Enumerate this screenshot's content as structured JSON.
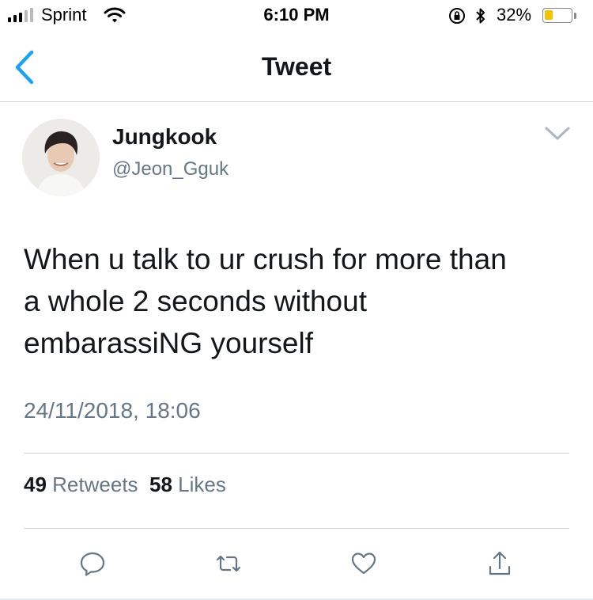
{
  "status_bar": {
    "carrier": "Sprint",
    "time": "6:10 PM",
    "battery_percent_text": "32%",
    "battery_level": 0.32,
    "signal_bars": 3,
    "icons": [
      "signal-icon",
      "wifi-icon",
      "rotation-lock-icon",
      "bluetooth-icon",
      "battery-icon"
    ]
  },
  "nav": {
    "title": "Tweet",
    "back_icon": "chevron-left-icon"
  },
  "tweet": {
    "author_name": "Jungkook",
    "author_handle": "@Jeon_Gguk",
    "text_lines": [
      "When u talk to ur crush for more than",
      "a whole 2 seconds without",
      "embarassiNG yourself"
    ],
    "timestamp": "24/11/2018, 18:06",
    "retweets_count": "49",
    "retweets_label": "Retweets",
    "likes_count": "58",
    "likes_label": "Likes"
  },
  "actions": [
    {
      "icon": "reply-icon"
    },
    {
      "icon": "retweet-icon"
    },
    {
      "icon": "like-icon"
    },
    {
      "icon": "share-icon"
    }
  ],
  "colors": {
    "accent": "#1da1f2",
    "text_primary": "#14171a",
    "text_secondary": "#657786",
    "divider": "#cfd3d6",
    "battery_fill": "#f5c400"
  }
}
